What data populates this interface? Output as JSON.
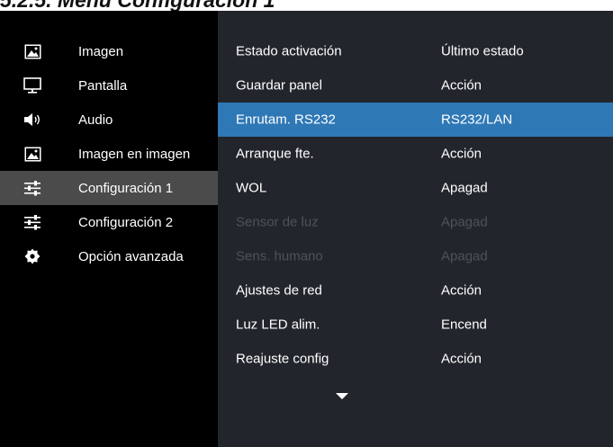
{
  "heading": "5.2.5. Menú Configuración 1",
  "sidebar": {
    "items": [
      {
        "label": "Imagen",
        "icon": "image-icon"
      },
      {
        "label": "Pantalla",
        "icon": "monitor-icon"
      },
      {
        "label": "Audio",
        "icon": "speaker-icon"
      },
      {
        "label": "Imagen en imagen",
        "icon": "picture-in-picture-icon"
      },
      {
        "label": "Configuración 1",
        "icon": "sliders-icon",
        "selected": true
      },
      {
        "label": "Configuración 2",
        "icon": "sliders-icon"
      },
      {
        "label": "Opción avanzada",
        "icon": "gear-icon"
      }
    ]
  },
  "settings": [
    {
      "name": "Estado activación",
      "value": "Último estado"
    },
    {
      "name": "Guardar panel",
      "value": "Acción"
    },
    {
      "name": "Enrutam. RS232",
      "value": "RS232/LAN",
      "highlighted": true
    },
    {
      "name": "Arranque fte.",
      "value": "Acción"
    },
    {
      "name": "WOL",
      "value": "Apagad"
    },
    {
      "name": "Sensor de luz",
      "value": "Apagad",
      "disabled": true
    },
    {
      "name": "Sens. humano",
      "value": "Apagad",
      "disabled": true
    },
    {
      "name": "Ajustes de red",
      "value": "Acción"
    },
    {
      "name": "Luz LED alim.",
      "value": "Encend"
    },
    {
      "name": "Reajuste config",
      "value": "Acción"
    }
  ],
  "scroll_indicator_icon": "chevron-down-icon",
  "colors": {
    "sidebar_bg": "#000000",
    "sidebar_selected": "#4b4b4b",
    "content_bg": "#22262c",
    "highlight": "#2f78b6",
    "text": "#ffffff",
    "disabled_text": "#4d525a"
  }
}
